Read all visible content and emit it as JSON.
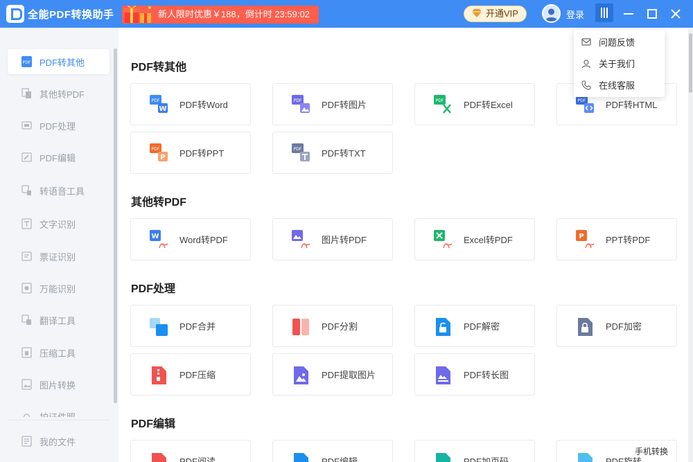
{
  "app": {
    "title": "全能PDF转换助手"
  },
  "titlebar": {
    "promo_text": "新人限时优惠￥188，倒计时 23:59:02",
    "vip_label": "开通VIP",
    "login_label": "登录"
  },
  "dropdown": {
    "items": [
      {
        "label": "问题反馈",
        "icon": "mail-icon"
      },
      {
        "label": "关于我们",
        "icon": "user-icon"
      },
      {
        "label": "在线客服",
        "icon": "phone-icon"
      }
    ]
  },
  "sidebar": {
    "items": [
      {
        "label": "PDF转其他",
        "active": true
      },
      {
        "label": "其他转PDF"
      },
      {
        "label": "PDF处理"
      },
      {
        "label": "PDF编辑"
      },
      {
        "label": "转语音工具"
      },
      {
        "label": "文字识别"
      },
      {
        "label": "票证识别"
      },
      {
        "label": "万能识别"
      },
      {
        "label": "翻译工具"
      },
      {
        "label": "压缩工具"
      },
      {
        "label": "图片转换"
      },
      {
        "label": "护证件照"
      }
    ],
    "my_files": "我的文件"
  },
  "sections": [
    {
      "title": "PDF转其他",
      "cards": [
        "PDF转Word",
        "PDF转图片",
        "PDF转Excel",
        "PDF转HTML",
        "PDF转PPT",
        "PDF转TXT"
      ]
    },
    {
      "title": "其他转PDF",
      "cards": [
        "Word转PDF",
        "图片转PDF",
        "Excel转PDF",
        "PPT转PDF"
      ]
    },
    {
      "title": "PDF处理",
      "cards": [
        "PDF合并",
        "PDF分割",
        "PDF解密",
        "PDF加密",
        "PDF压缩",
        "PDF提取图片",
        "PDF转长图"
      ]
    },
    {
      "title": "PDF编辑",
      "cards": [
        "PDF阅读",
        "PDF编辑",
        "PDF加页码",
        "PDF旋转"
      ]
    }
  ],
  "mobile_label": "手机转换",
  "colors": {
    "brand": "#3f8cf5",
    "promo": "#ff5e4d",
    "word": "#3b7ef0",
    "excel": "#1fb86b",
    "ppt": "#f26b2a",
    "red": "#f0534f"
  }
}
